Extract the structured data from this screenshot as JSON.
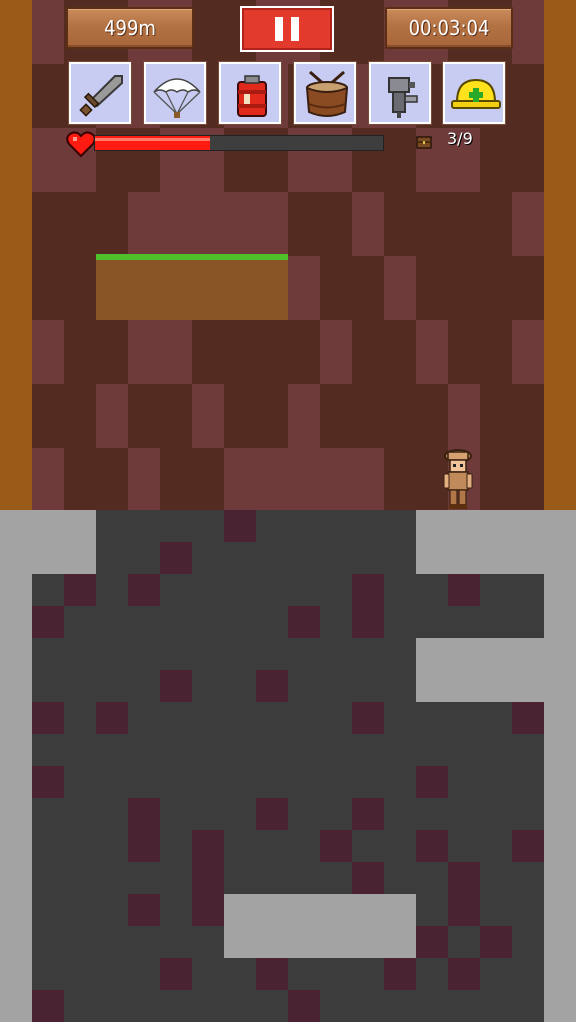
{
  "hud": {
    "depth": "499m",
    "time": "00:03:04",
    "pause_label": "pause",
    "treasure_count": "3/9",
    "health_fraction": 0.4
  },
  "inventory": [
    {
      "icon": "sword-icon"
    },
    {
      "icon": "parachute-icon"
    },
    {
      "icon": "dynamite-icon"
    },
    {
      "icon": "drum-icon"
    },
    {
      "icon": "drill-icon"
    },
    {
      "icon": "helmet-icon"
    }
  ],
  "colors": {
    "dirt_light": "#6f3a3a",
    "dirt_dark": "#532b20",
    "dirt_edge": "#9a5a18",
    "stone_light": "#a3a3a3",
    "stone_dark": "#3c3c3c",
    "health": "#ff1a12",
    "pause": "#e23a2c"
  }
}
